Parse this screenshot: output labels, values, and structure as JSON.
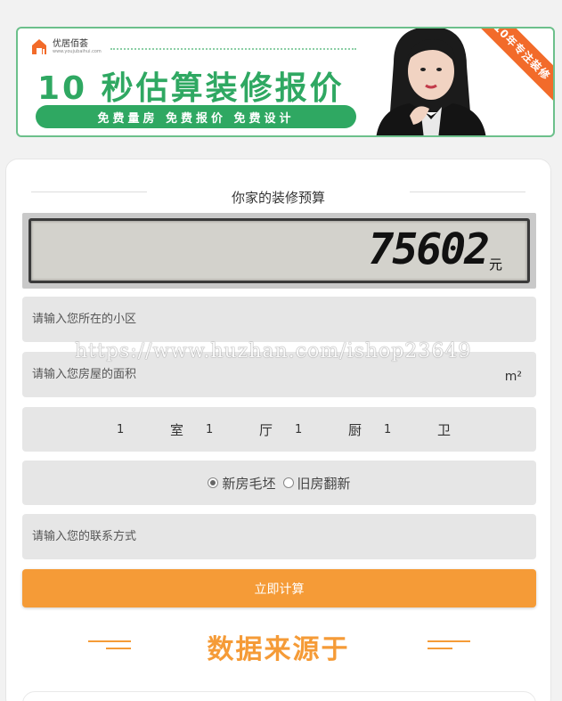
{
  "banner": {
    "logo_text": "优居佰荟",
    "logo_url_text": "www.youjubaihui.com",
    "headline": "10 秒估算装修报价",
    "subline": "免费量房  免费报价  免费设计",
    "ribbon": "10年专注装修"
  },
  "calculator": {
    "title": "你家的装修预算",
    "amount": "75602",
    "amount_unit": "元",
    "community_placeholder": "请输入您所在的小区",
    "area_placeholder": "请输入您房屋的面积",
    "area_unit": "m²",
    "rooms": [
      {
        "value": "1",
        "label": "室"
      },
      {
        "value": "1",
        "label": "厅"
      },
      {
        "value": "1",
        "label": "厨"
      },
      {
        "value": "1",
        "label": "卫"
      }
    ],
    "house_types": [
      {
        "label": "新房毛坯",
        "checked": true
      },
      {
        "label": "旧房翻新",
        "checked": false
      }
    ],
    "contact_placeholder": "请输入您的联系方式",
    "submit_label": "立即计算"
  },
  "data_source": {
    "title": "数据来源于"
  },
  "watermark": "https://www.huzhan.com/ishop23649",
  "colors": {
    "brand_green": "#2fa862",
    "accent_orange": "#f59b37",
    "ribbon_orange": "#f26b2a"
  }
}
